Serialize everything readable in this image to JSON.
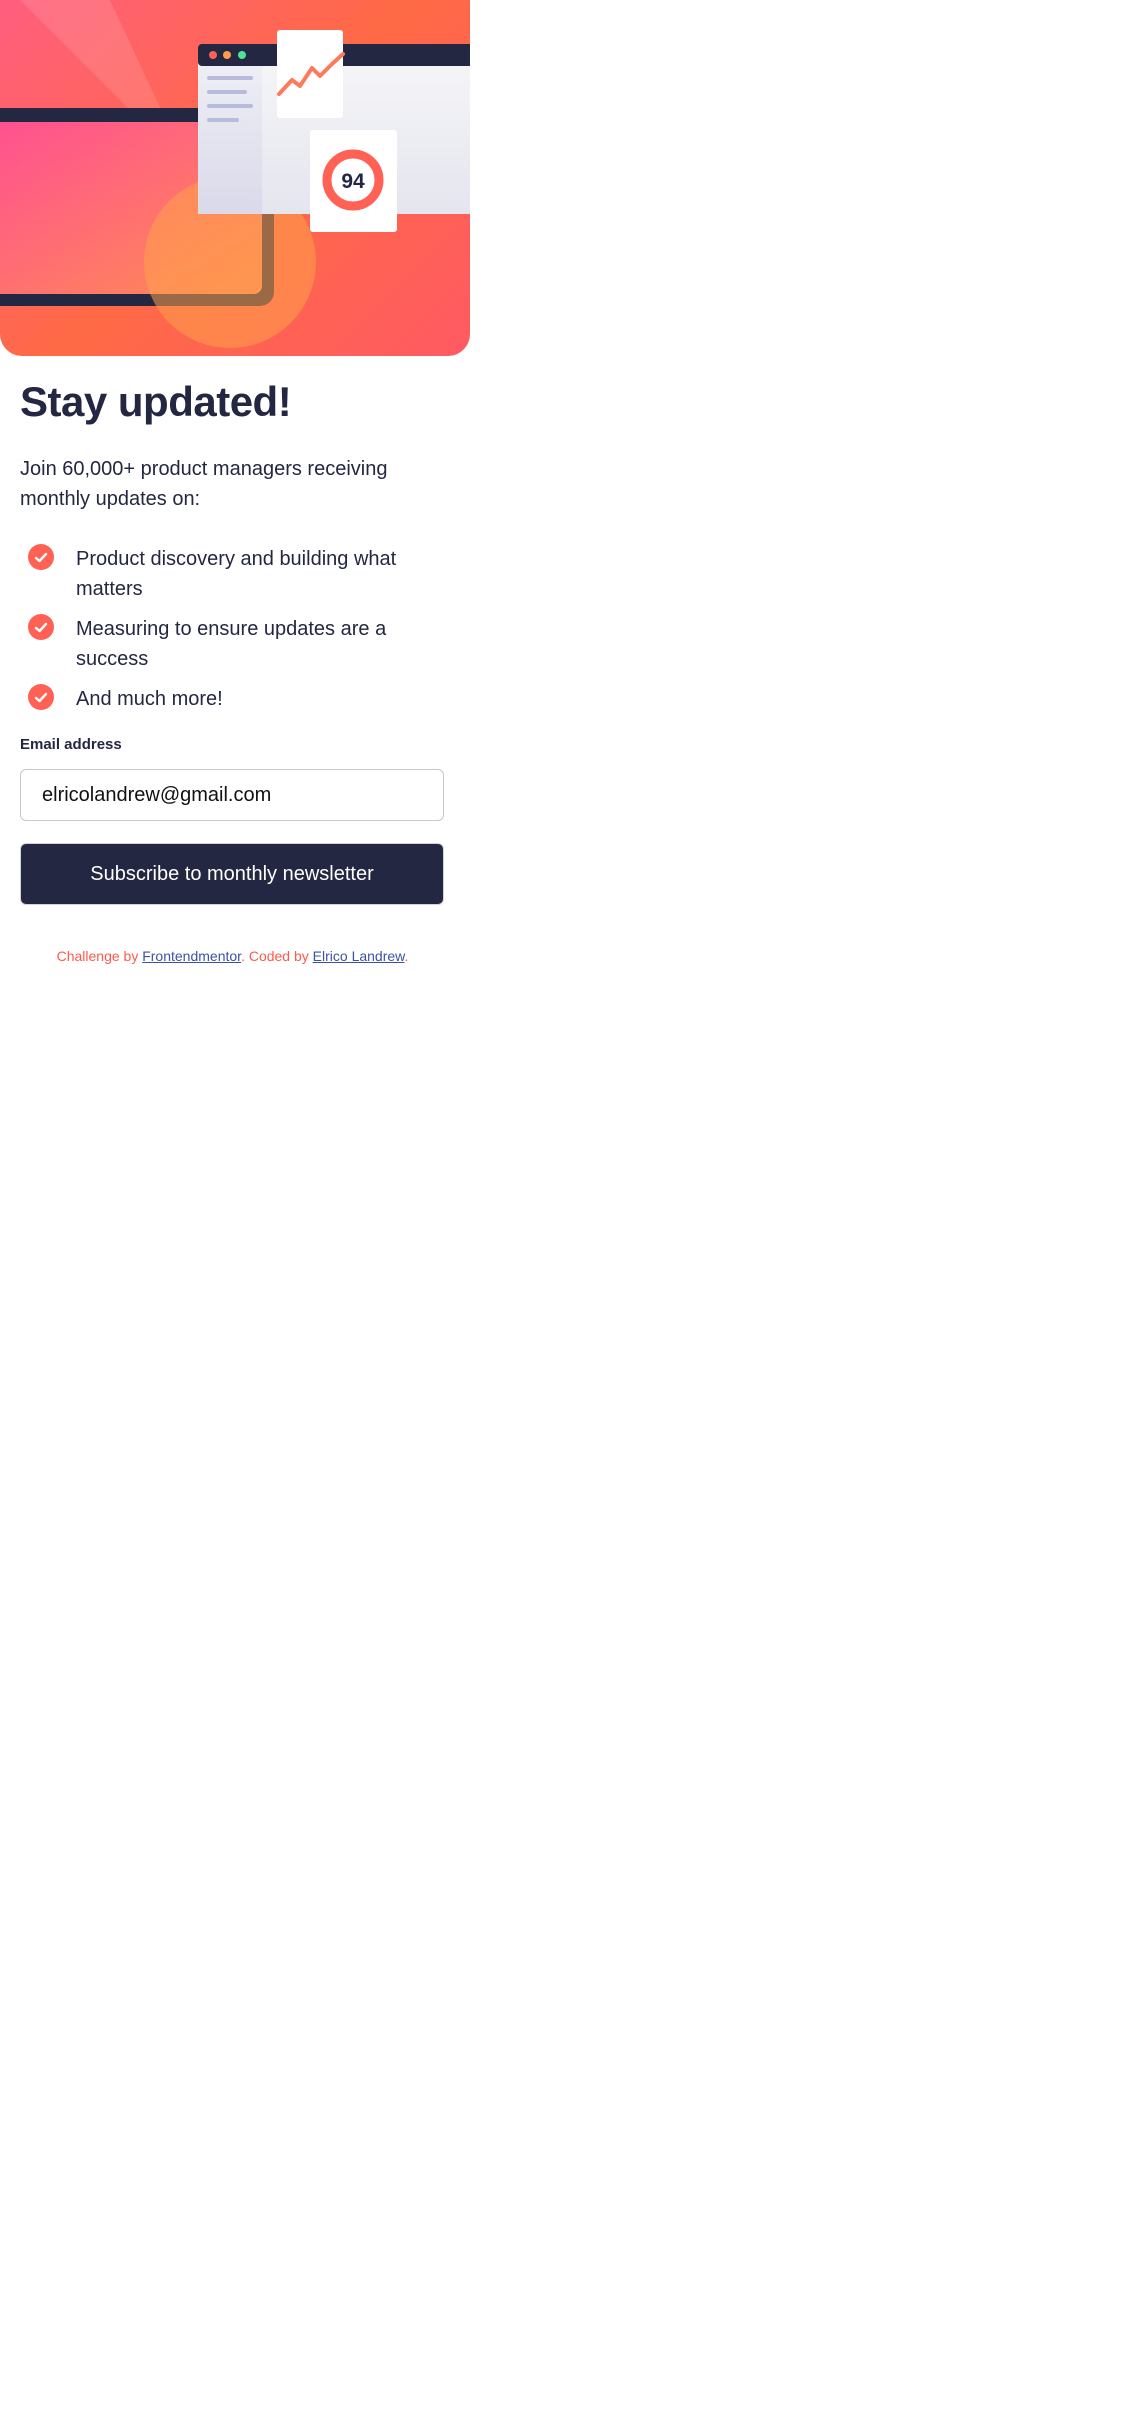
{
  "hero": {
    "score": "94",
    "icons": [
      "browser-window-icon",
      "line-chart-icon",
      "score-ring-icon",
      "tablet-device-icon"
    ]
  },
  "title": "Stay updated!",
  "intro": "Join 60,000+ product managers receiving monthly updates on:",
  "features": [
    "Product discovery and building what matters",
    "Measuring to ensure updates are a success",
    "And much more!"
  ],
  "form": {
    "email_label": "Email address",
    "email_value": "elricolandrew@gmail.com",
    "submit_label": "Subscribe to monthly newsletter"
  },
  "footer": {
    "prefix": "Challenge by ",
    "challenge_link": "Frontendmentor",
    "middle": ". Coded by ",
    "author_link": "Elrico Landrew",
    "suffix": "."
  },
  "colors": {
    "accent": "#ff6155",
    "dark_navy": "#242742",
    "link": "#3e52a3",
    "white": "#ffffff"
  }
}
